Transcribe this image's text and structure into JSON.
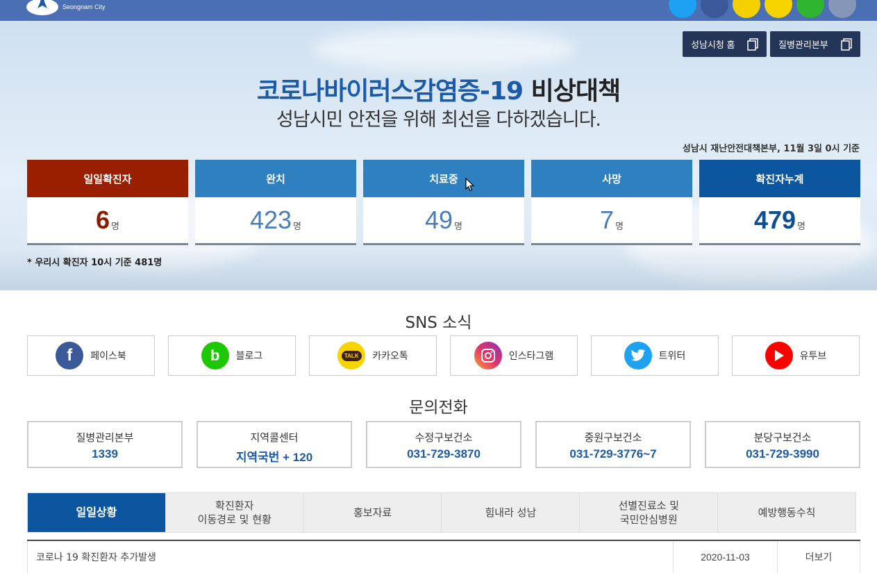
{
  "header": {
    "logo_text": "Seongnam City",
    "colors": {
      "bar": "#4a6fb5"
    },
    "top_icons": [
      {
        "name": "twitter-icon",
        "color": "#1da1f2"
      },
      {
        "name": "facebook-icon",
        "color": "#3b5998"
      },
      {
        "name": "blog-icon",
        "color": "#f5d000"
      },
      {
        "name": "kakaotalk-icon",
        "color": "#f7d400"
      },
      {
        "name": "band-icon",
        "color": "#2fb52f"
      },
      {
        "name": "qr-icon",
        "color": "#8596b8"
      }
    ]
  },
  "hero": {
    "buttons": [
      {
        "label": "성남시청 홈"
      },
      {
        "label": "질병관리본부"
      }
    ],
    "title_blue": "코로나바이러스감염증-19",
    "title_dark": " 비상대책",
    "subtitle": "성남시민 안전을 위해 최선을 다하겠습니다.",
    "basis": "성남시 재난안전대책본부, 11월 3일 0시 기준",
    "stats": [
      {
        "label": "일일확진자",
        "value": "6",
        "unit": "명",
        "head_color": "#9a1f00",
        "num_color": "#8c1c00"
      },
      {
        "label": "완치",
        "value": "423",
        "unit": "명",
        "head_color": "#2f80c0",
        "num_color": "#4a7db8"
      },
      {
        "label": "치료중",
        "value": "49",
        "unit": "명",
        "head_color": "#2f80c0",
        "num_color": "#4a7db8"
      },
      {
        "label": "사망",
        "value": "7",
        "unit": "명",
        "head_color": "#2f80c0",
        "num_color": "#4a7db8"
      },
      {
        "label": "확진자누계",
        "value": "479",
        "unit": "명",
        "head_color": "#0c56a0",
        "num_color": "#0c4f93"
      }
    ],
    "note": "* 우리시 확진자 10시 기준 481명"
  },
  "sns": {
    "title": "SNS 소식",
    "items": [
      {
        "label": "페이스북",
        "icon": "facebook-icon",
        "color": "#3b5998",
        "glyph": "f"
      },
      {
        "label": "블로그",
        "icon": "blog-icon",
        "color": "#1ec800",
        "glyph": "b"
      },
      {
        "label": "카카오톡",
        "icon": "kakaotalk-icon",
        "color": "#f7d400",
        "glyph": "TALK"
      },
      {
        "label": "인스타그램",
        "icon": "instagram-icon",
        "color": "#c13584",
        "glyph": ""
      },
      {
        "label": "트위터",
        "icon": "twitter-icon",
        "color": "#1da1f2",
        "glyph": ""
      },
      {
        "label": "유투브",
        "icon": "youtube-icon",
        "color": "#ff0000",
        "glyph": ""
      }
    ]
  },
  "contact": {
    "title": "문의전화",
    "items": [
      {
        "label": "질병관리본부",
        "number": "1339"
      },
      {
        "label": "지역콜센터",
        "number_kr": "지역국번",
        "number": " + 120"
      },
      {
        "label": "수정구보건소",
        "number": "031-729-3870"
      },
      {
        "label": "중원구보건소",
        "number": "031-729-3776~7"
      },
      {
        "label": "분당구보건소",
        "number": "031-729-3990"
      }
    ]
  },
  "tabs": [
    {
      "line1": "일일상황",
      "line2": ""
    },
    {
      "line1": "확진환자",
      "line2": "이동경로 및 현황"
    },
    {
      "line1": "홍보자료",
      "line2": ""
    },
    {
      "line1": "힘내라 성남",
      "line2": ""
    },
    {
      "line1": "선별진료소 및",
      "line2": "국민안심병원"
    },
    {
      "line1": "예방행동수칙",
      "line2": ""
    }
  ],
  "list": {
    "rows": [
      {
        "title": "코로나 19 확진환자 추가발생",
        "date": "2020-11-03",
        "more": "더보기"
      }
    ]
  }
}
